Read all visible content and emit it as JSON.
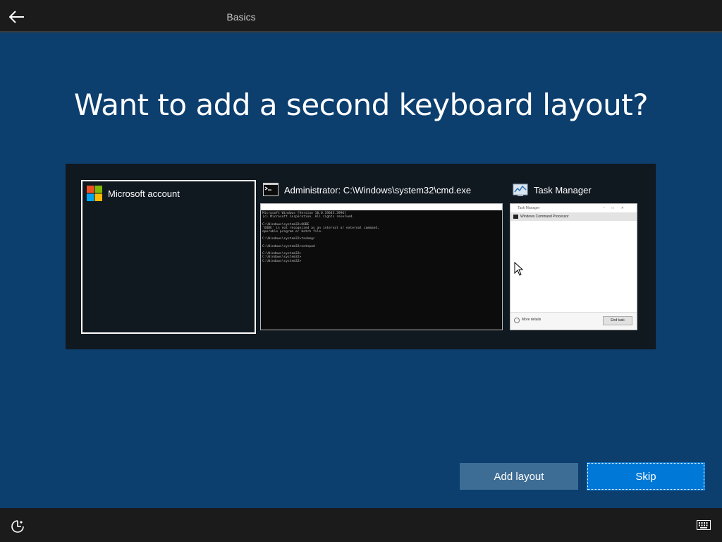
{
  "header": {
    "back_icon": "back-arrow-icon",
    "tab_label": "Basics"
  },
  "heading": "Want to add a second keyboard layout?",
  "switcher": {
    "windows": [
      {
        "title": "Microsoft account",
        "icon": "microsoft-logo-icon",
        "selected": true
      },
      {
        "title": "Administrator: C:\\Windows\\system32\\cmd.exe",
        "icon": "cmd-icon",
        "selected": false,
        "console_lines": "Microsoft Windows [Version 10.0.19045.3996]\n(c) Microsoft Corporation. All rights reserved.\n\nC:\\Windows\\system32>OOBE\n'OOBE' is not recognized as an internal or external command,\noperable program or batch file.\n\nC:\\Windows\\system32>taskmgr\n\nC:\\Windows\\system32>notepad\n\nC:\\Windows\\system32>\nC:\\Windows\\system32>\nC:\\Windows\\system32>"
      },
      {
        "title": "Task Manager",
        "icon": "task-manager-icon",
        "selected": false,
        "tm_title": "Task Manager",
        "tm_row": "Windows Command Processor",
        "tm_more": "More details",
        "tm_end": "End task"
      }
    ]
  },
  "buttons": {
    "add_layout": "Add layout",
    "skip": "Skip"
  },
  "footer": {
    "accessibility_icon": "ease-of-access-icon",
    "keyboard_icon": "keyboard-icon"
  },
  "colors": {
    "background": "#0c3e6e",
    "accent": "#0078d7",
    "secondary_button": "#3d6d95",
    "bar": "#1b1b1b"
  }
}
